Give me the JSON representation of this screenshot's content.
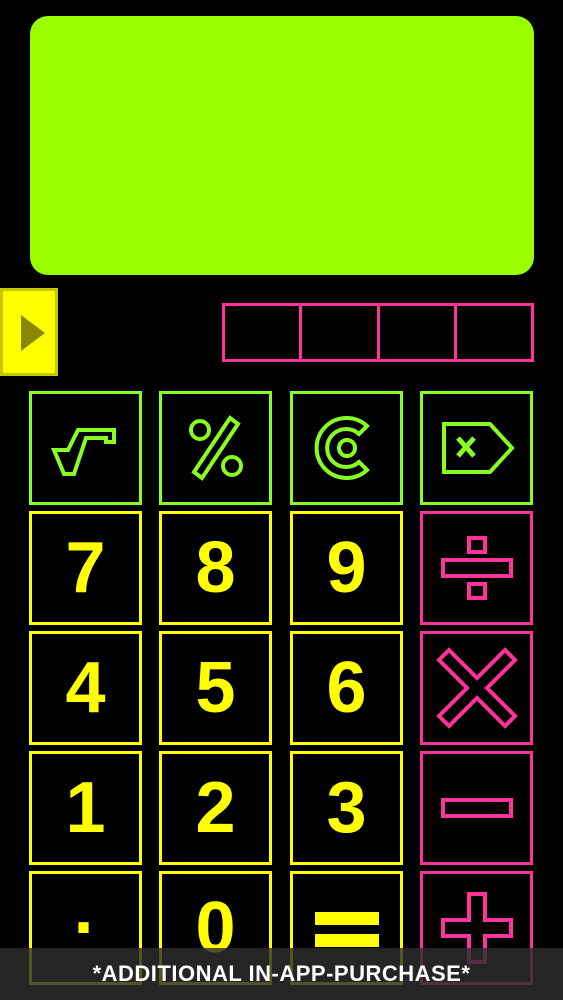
{
  "display": {
    "value": ""
  },
  "side_button": {
    "icon": "play-arrow-icon"
  },
  "memory_slots": [
    "",
    "",
    "",
    ""
  ],
  "keys": {
    "seven": "7",
    "eight": "8",
    "nine": "9",
    "four": "4",
    "five": "5",
    "six": "6",
    "one": "1",
    "two": "2",
    "three": "3",
    "decimal": "·",
    "zero": "0"
  },
  "function_icons": [
    "square-root-icon",
    "percent-icon",
    "clear-icon",
    "backspace-icon"
  ],
  "operator_icons": [
    "divide-icon",
    "multiply-icon",
    "minus-icon",
    "plus-icon",
    "equals-icon"
  ],
  "banner": {
    "text": "*ADDITIONAL IN-APP-PURCHASE*"
  },
  "colors": {
    "display": "#99ff00",
    "function": "#88ff22",
    "digit": "#ffff00",
    "operator": "#ff3399",
    "background": "#000000"
  }
}
